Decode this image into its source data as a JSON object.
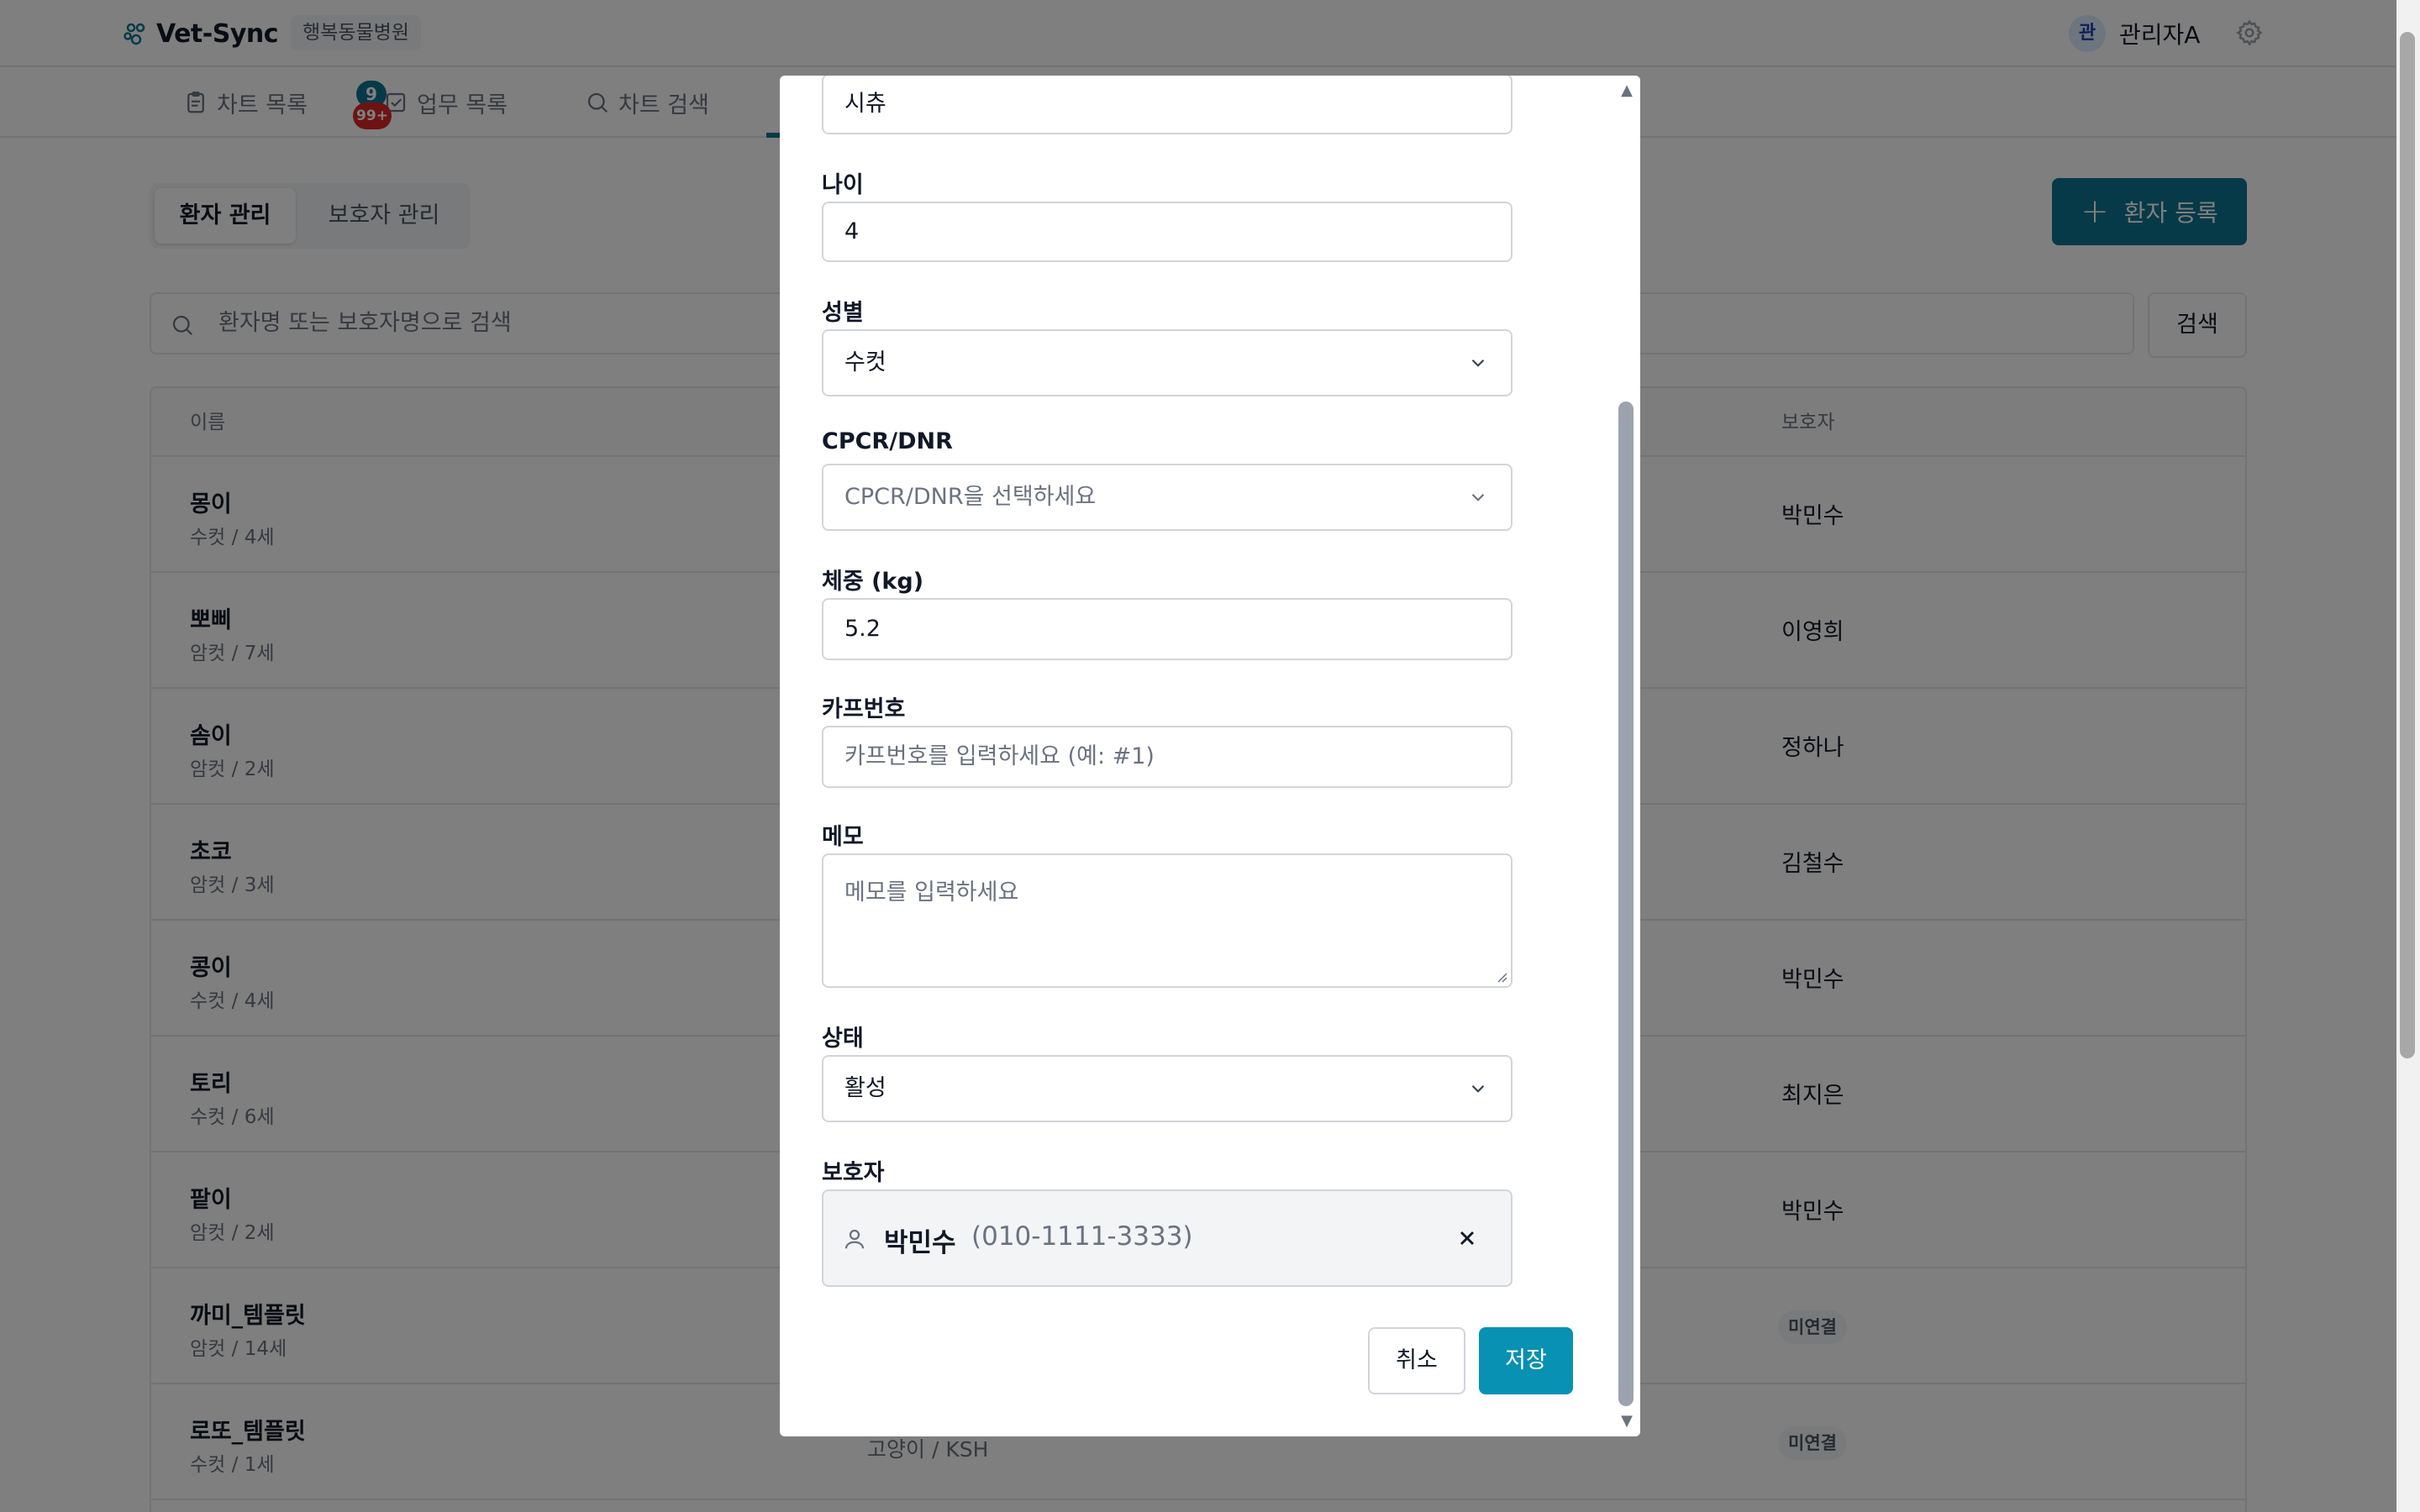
{
  "header": {
    "app_name": "Vet-Sync",
    "hospital": "행복동물병원",
    "user_avatar": "관",
    "user_name": "관리자A"
  },
  "nav_tabs": [
    {
      "label": "차트 목록",
      "icon": "clipboard-icon"
    },
    {
      "label": "업무 목록",
      "icon": "checkbox-icon"
    },
    {
      "label": "차트 검색",
      "icon": "search-icon"
    }
  ],
  "badges": {
    "blue": "9",
    "red": "99+"
  },
  "segments": {
    "patients": "환자 관리",
    "owners": "보호자 관리"
  },
  "add_button": "환자 등록",
  "search": {
    "placeholder": "환자명 또는 보호자명으로 검색",
    "button": "검색"
  },
  "table": {
    "headers": {
      "name": "이름",
      "owner": "보호자"
    },
    "rows": [
      {
        "name": "몽이",
        "info": "수컷 / 4세",
        "mid": "",
        "owner": "박민수"
      },
      {
        "name": "뽀삐",
        "info": "암컷 / 7세",
        "mid": "",
        "owner": "이영희"
      },
      {
        "name": "솜이",
        "info": "암컷 / 2세",
        "mid": "",
        "owner": "정하나"
      },
      {
        "name": "초코",
        "info": "암컷 / 3세",
        "mid": "",
        "owner": "김철수"
      },
      {
        "name": "콩이",
        "info": "수컷 / 4세",
        "mid": "",
        "owner": "박민수"
      },
      {
        "name": "토리",
        "info": "수컷 / 6세",
        "mid": "",
        "owner": "최지은"
      },
      {
        "name": "팥이",
        "info": "암컷 / 2세",
        "mid": "",
        "owner": "박민수"
      },
      {
        "name": "까미_템플릿",
        "info": "암컷 / 14세",
        "mid": "",
        "owner": "미연결"
      },
      {
        "name": "로또_템플릿",
        "info": "수컷 / 1세",
        "mid": "고양이 / KSH",
        "owner": "미연결"
      }
    ]
  },
  "modal": {
    "breed_value": "시츄",
    "age_label": "나이",
    "age_value": "4",
    "sex_label": "성별",
    "sex_value": "수컷",
    "cpcr_label": "CPCR/DNR",
    "cpcr_placeholder": "CPCR/DNR을 선택하세요",
    "weight_label": "체중 (kg)",
    "weight_value": "5.2",
    "cage_label": "카프번호",
    "cage_placeholder": "카프번호를 입력하세요 (예: #1)",
    "memo_label": "메모",
    "memo_placeholder": "메모를 입력하세요",
    "status_label": "상태",
    "status_value": "활성",
    "owner_label": "보호자",
    "owner_name": "박민수",
    "owner_phone": "(010-1111-3333)",
    "cancel": "취소",
    "save": "저장"
  },
  "colors": {
    "primary": "#0e7490",
    "save": "#0891b2",
    "badge_red": "#dc2626"
  }
}
